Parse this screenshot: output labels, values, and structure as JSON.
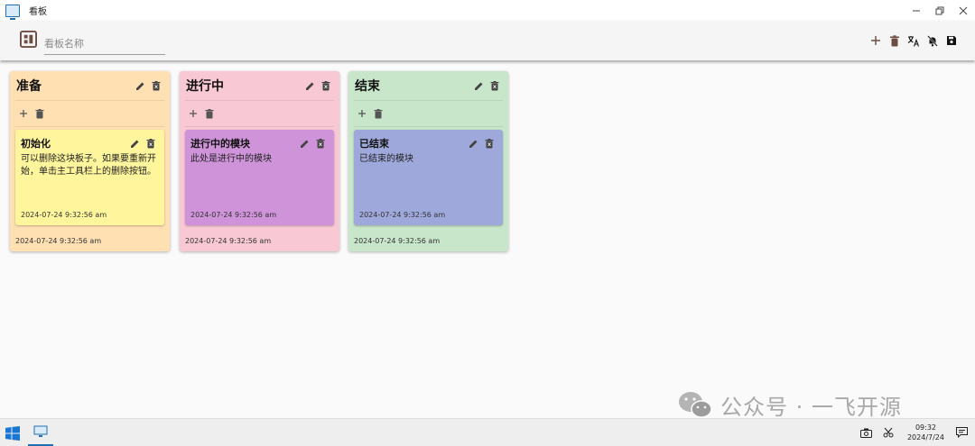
{
  "window": {
    "title": "看板",
    "controls": [
      "minimize",
      "restore",
      "close"
    ]
  },
  "appbar": {
    "board_name_placeholder": "看板名称",
    "board_name_value": "",
    "toolbar": [
      "add-icon",
      "delete-icon",
      "translate-icon",
      "notifications-off-icon",
      "save-icon"
    ]
  },
  "columns": [
    {
      "title": "准备",
      "color": "#ffe0b2",
      "date": "2024-07-24 9:32:56 am",
      "card": {
        "title": "初始化",
        "body": "可以删除这块板子。如果要重新开始，单击主工具栏上的删除按钮。",
        "color": "#fff59d",
        "date": "2024-07-24 9:32:56 am"
      }
    },
    {
      "title": "进行中",
      "color": "#f8c8d4",
      "date": "2024-07-24 9:32:56 am",
      "card": {
        "title": "进行中的模块",
        "body": "此处是进行中的模块",
        "color": "#ce93d8",
        "date": "2024-07-24 9:32:56 am"
      }
    },
    {
      "title": "结束",
      "color": "#c8e6c9",
      "date": "2024-07-24 9:32:56 am",
      "card": {
        "title": "已结束",
        "body": "已结束的模块",
        "color": "#9fa8da",
        "date": "2024-07-24 9:32:56 am"
      }
    }
  ],
  "taskbar": {
    "time": "09:32",
    "date": "2024/7/24"
  },
  "watermark": {
    "text": "公众号 · 一飞开源"
  }
}
